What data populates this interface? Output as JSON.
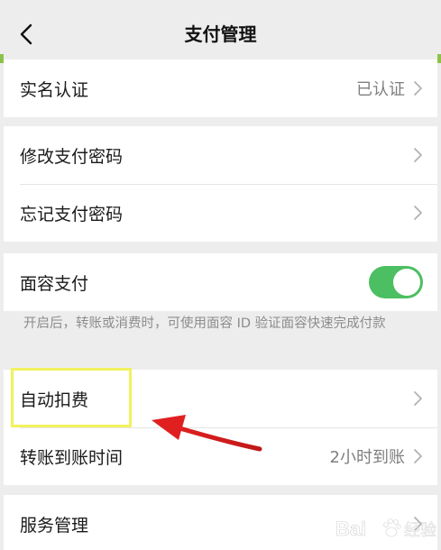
{
  "header": {
    "title": "支付管理",
    "back_icon": "chevron-left-icon"
  },
  "rows": {
    "real_name": {
      "label": "实名认证",
      "value": "已认证"
    },
    "change_password": {
      "label": "修改支付密码"
    },
    "forgot_password": {
      "label": "忘记支付密码"
    },
    "face_pay": {
      "label": "面容支付",
      "toggle_on": true
    },
    "auto_deduct": {
      "label": "自动扣费"
    },
    "transfer_time": {
      "label": "转账到账时间",
      "value": "2小时到账"
    },
    "service_manage": {
      "label": "服务管理"
    }
  },
  "face_pay_note": "开启后，转账或消费时，可使用面容 ID 验证面容快速完成付款",
  "colors": {
    "toggle_on": "#4cbf62",
    "highlight": "#f2f25e",
    "arrow": "#e02020",
    "green_strip": "#8bc34a"
  },
  "watermark": {
    "text": "Bai",
    "icon": "paw-icon",
    "suffix": "经验"
  }
}
